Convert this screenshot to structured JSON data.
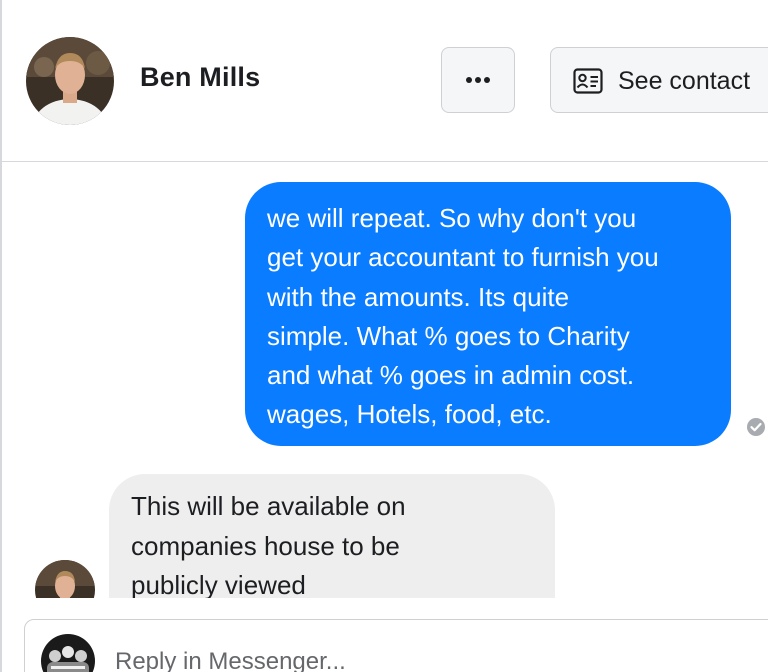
{
  "header": {
    "contact_name": "Ben Mills",
    "see_contact_label": "See contact"
  },
  "messages": [
    {
      "direction": "outgoing",
      "text": "we will repeat. So why don't you\nget your accountant to furnish you\nwith the amounts. Its quite\nsimple. What % goes to Charity\nand what % goes in admin cost.\nwages, Hotels, food, etc.",
      "status": "sent"
    },
    {
      "direction": "incoming",
      "text": "This will be available on\ncompanies house to be\npublicly viewed"
    }
  ],
  "reply": {
    "placeholder": "Reply in Messenger..."
  },
  "colors": {
    "outgoing_bubble": "#0a7cff",
    "incoming_bubble": "#eeeeee",
    "text": "#1c1e21",
    "muted": "#65676b"
  },
  "icons": {
    "more": "more-horizontal-icon",
    "contact": "contact-card-icon",
    "status": "sent-check-icon"
  }
}
